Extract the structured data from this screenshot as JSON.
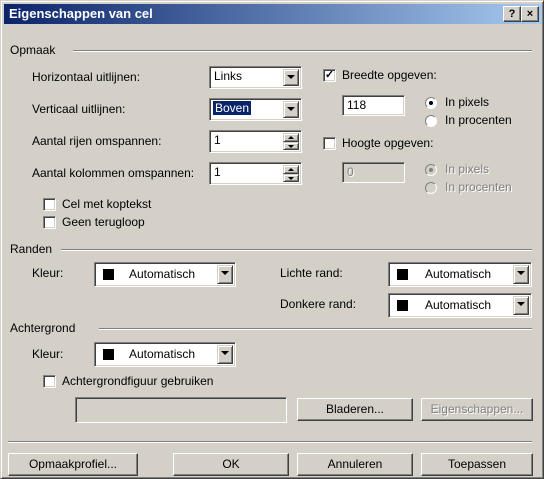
{
  "window": {
    "title": "Eigenschappen van cel",
    "help_label": "?",
    "close_label": "×"
  },
  "layout_group": {
    "title": "Opmaak",
    "horizontal_label": "Horizontaal uitlijnen:",
    "horizontal_value": "Links",
    "vertical_label": "Verticaal uitlijnen:",
    "vertical_value": "Boven",
    "rows_label": "Aantal rijen omspannen:",
    "rows_value": "1",
    "cols_label": "Aantal kolommen omspannen:",
    "cols_value": "1",
    "header_check_label": "Cel met koptekst",
    "header_checked": false,
    "nowrap_check_label": "Geen terugloop",
    "nowrap_checked": false,
    "width_check_label": "Breedte opgeven:",
    "width_checked": true,
    "width_value": "118",
    "width_pixels_label": "In pixels",
    "width_percent_label": "In procenten",
    "height_check_label": "Hoogte opgeven:",
    "height_checked": false,
    "height_value": "0",
    "height_pixels_label": "In pixels",
    "height_percent_label": "In procenten"
  },
  "borders_group": {
    "title": "Randen",
    "color_label": "Kleur:",
    "color_value": "Automatisch",
    "light_label": "Lichte rand:",
    "light_value": "Automatisch",
    "dark_label": "Donkere rand:",
    "dark_value": "Automatisch"
  },
  "background_group": {
    "title": "Achtergrond",
    "color_label": "Kleur:",
    "color_value": "Automatisch",
    "image_check_label": "Achtergrondfiguur gebruiken",
    "image_checked": false,
    "image_path": "",
    "browse_label": "Bladeren...",
    "properties_label": "Eigenschappen..."
  },
  "buttons": {
    "style_label": "Opmaakprofiel...",
    "ok_label": "OK",
    "cancel_label": "Annuleren",
    "apply_label": "Toepassen"
  },
  "colors": {
    "title_start": "#0a246a",
    "title_end": "#a6caf0",
    "face": "#d4d0c8",
    "selection": "#0a246a"
  }
}
